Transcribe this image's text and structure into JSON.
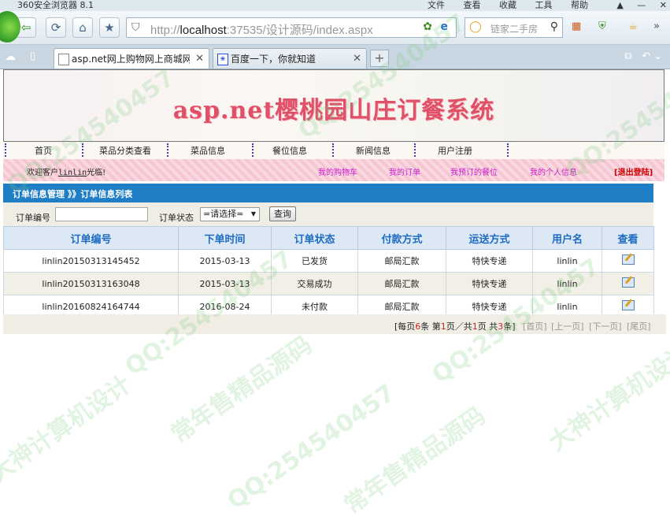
{
  "browser": {
    "app_title": "360安全浏览器 8.1",
    "menus": [
      "文件",
      "查看",
      "收藏",
      "工具",
      "帮助"
    ],
    "address": {
      "url_prefix": "http://",
      "url_host": "localhost",
      "url_rest": ":37535/设计源码/index.aspx"
    },
    "search_placeholder": "链家二手房",
    "tabs": [
      {
        "label": "asp.net网上购物网上商城网站",
        "active": true
      },
      {
        "label": "百度一下，你就知道",
        "active": false
      }
    ],
    "new_tab": "+"
  },
  "page": {
    "site_title": "asp.net樱桃园山庄订餐系统",
    "nav": [
      "首页",
      "菜品分类查看",
      "菜品信息",
      "餐位信息",
      "新闻信息",
      "用户注册"
    ],
    "welcome": {
      "prefix": "欢迎客户",
      "user": "linlin",
      "suffix": "光临!"
    },
    "user_links": [
      "我的购物车",
      "我的订单",
      "我预订的餐位",
      "我的个人信息"
    ],
    "logout": "[退出登陆]",
    "breadcrumb": "订单信息管理 》》订单信息列表",
    "filter": {
      "order_no_label": "订单编号",
      "order_no_value": "",
      "status_label": "订单状态",
      "status_selected": "=请选择=",
      "query_button": "查询"
    },
    "table": {
      "headers": [
        "订单编号",
        "下单时间",
        "订单状态",
        "付款方式",
        "运送方式",
        "用户名",
        "查看"
      ],
      "rows": [
        [
          "linlin20150313145452",
          "2015-03-13",
          "已发货",
          "邮局汇款",
          "特快专递",
          "linlin"
        ],
        [
          "linlin20150313163048",
          "2015-03-13",
          "交易成功",
          "邮局汇款",
          "特快专递",
          "linlin"
        ],
        [
          "linlin20160824164744",
          "2016-08-24",
          "未付款",
          "邮局汇款",
          "特快专递",
          "linlin"
        ]
      ]
    },
    "pager": {
      "per_page_pre": "[每页",
      "per_page": "6",
      "per_page_post": "条 第",
      "current": "1",
      "current_post": "页／共",
      "total_pages": "1",
      "total_pages_post": "页 共",
      "total": "3",
      "total_post": "条]",
      "links": [
        "[首页]",
        "[上一页]",
        "[下一页]",
        "[尾页]"
      ]
    }
  },
  "watermark": [
    "QQ:254540457",
    "常年售精品源码",
    "大神计算机设计"
  ]
}
